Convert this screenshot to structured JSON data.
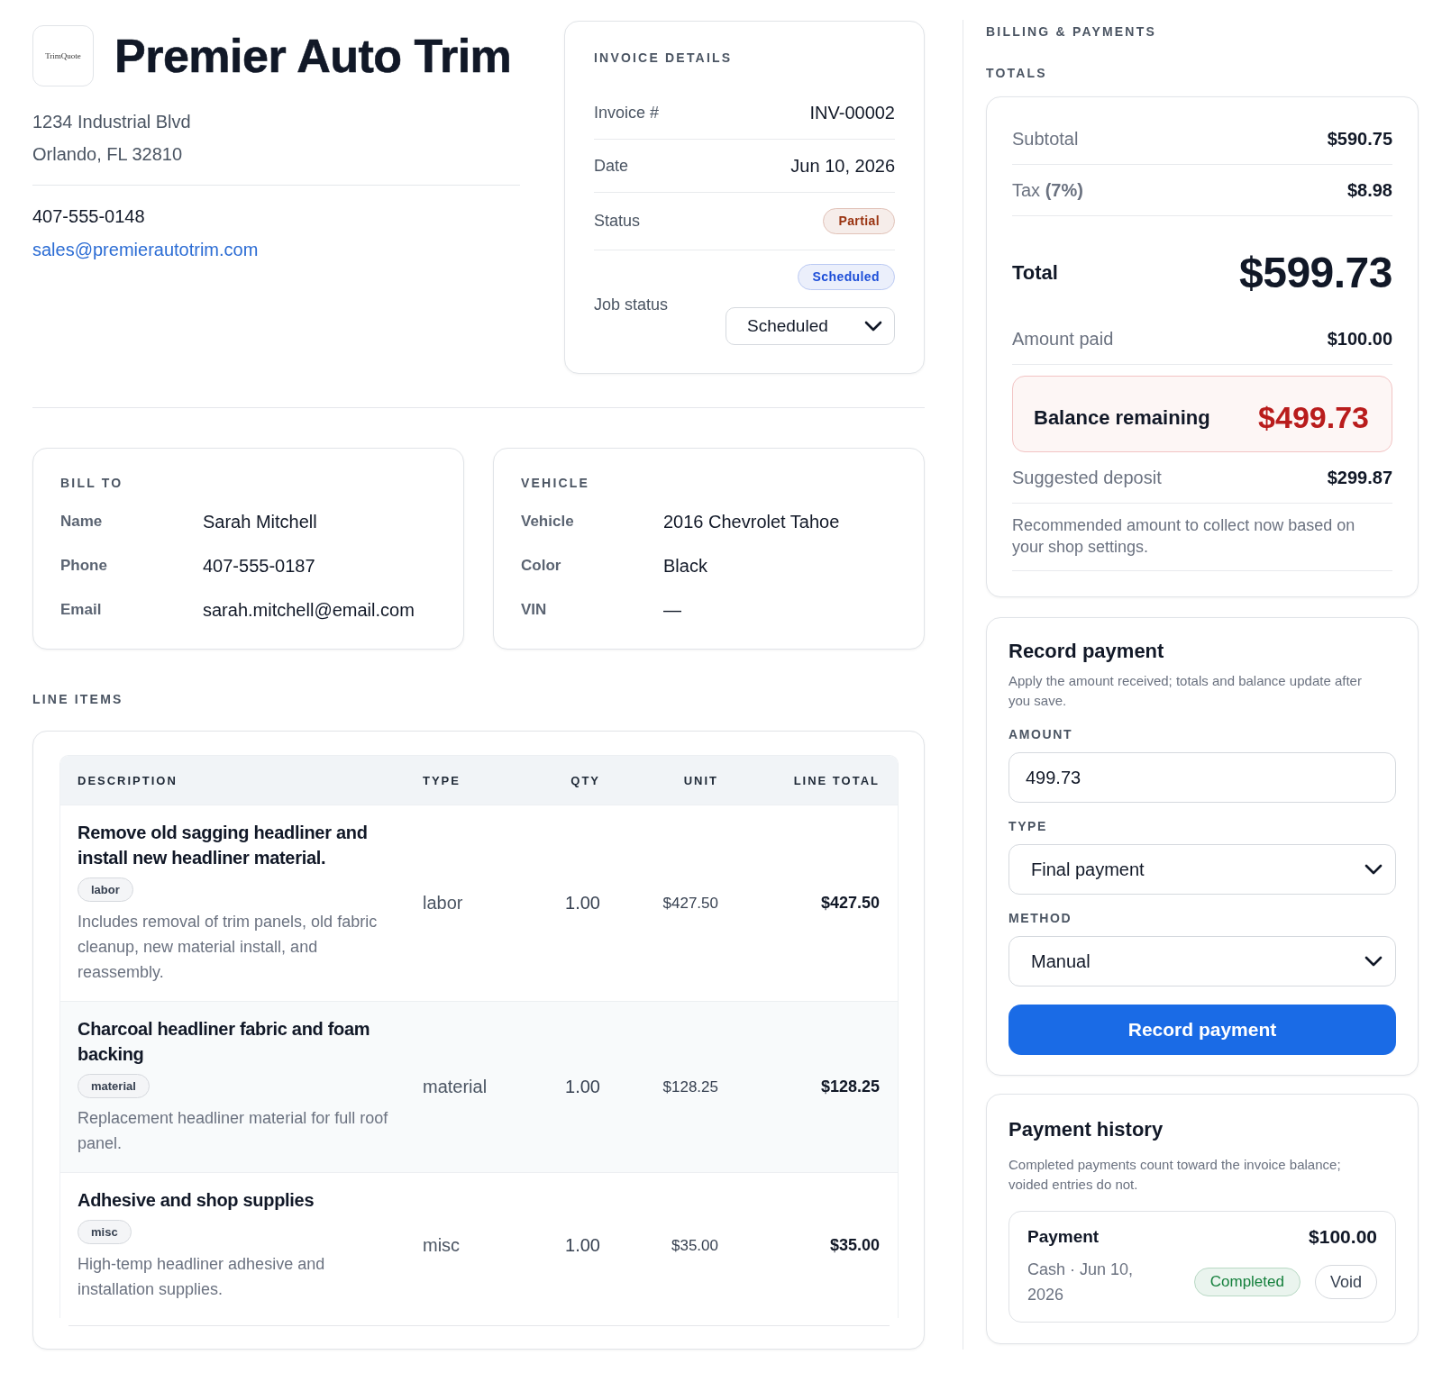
{
  "business": {
    "logo_text": "TrimQuote",
    "name": "Premier Auto Trim",
    "address_lines": [
      "1234 Industrial Blvd",
      "Orlando, FL 32810"
    ],
    "phone": "407-555-0148",
    "email": "sales@premierautotrim.com"
  },
  "invoice_details": {
    "heading": "INVOICE DETAILS",
    "rows": [
      {
        "kind": "text",
        "label": "Invoice #",
        "value": "INV-00002"
      },
      {
        "kind": "text",
        "label": "Date",
        "value": "Jun 10, 2026"
      },
      {
        "kind": "badge",
        "label": "Status",
        "value": "Partial",
        "color": "#9a3412"
      }
    ],
    "job_status": {
      "label": "Job status",
      "badge": {
        "label": "Scheduled",
        "color": "#1d4ed8"
      },
      "value": "Scheduled"
    }
  },
  "bill_to": {
    "heading": "BILL TO",
    "fields": [
      {
        "label": "Name",
        "value": "Sarah Mitchell"
      },
      {
        "label": "Phone",
        "value": "407-555-0187"
      },
      {
        "label": "Email",
        "value": "sarah.mitchell@email.com"
      }
    ]
  },
  "vehicle": {
    "heading": "VEHICLE",
    "fields": [
      {
        "label": "Vehicle",
        "value": "2016 Chevrolet Tahoe"
      },
      {
        "label": "Color",
        "value": "Black"
      },
      {
        "label": "VIN",
        "value": "—"
      }
    ]
  },
  "line_items": {
    "heading": "LINE ITEMS",
    "columns": [
      "DESCRIPTION",
      "TYPE",
      "QTY",
      "UNIT",
      "LINE TOTAL"
    ],
    "rows": [
      {
        "title": "Remove old sagging headliner and install new headliner material.",
        "tag": "labor",
        "note": "Includes removal of trim panels, old fabric cleanup, new material install, and reassembly.",
        "type": "labor",
        "qty": "1.00",
        "unit": "$427.50",
        "line_total": "$427.50"
      },
      {
        "title": "Charcoal headliner fabric and foam backing",
        "tag": "material",
        "note": "Replacement headliner material for full roof panel.",
        "type": "material",
        "qty": "1.00",
        "unit": "$128.25",
        "line_total": "$128.25"
      },
      {
        "title": "Adhesive and shop supplies",
        "tag": "misc",
        "note": "High-temp headliner adhesive and installation supplies.",
        "type": "misc",
        "qty": "1.00",
        "unit": "$35.00",
        "line_total": "$35.00"
      }
    ]
  },
  "billing": {
    "heading": "BILLING & PAYMENTS",
    "totals": {
      "heading": "TOTALS",
      "rows": [
        {
          "kind": "line",
          "label": "Subtotal",
          "value": "$590.75"
        },
        {
          "kind": "line",
          "label": "Tax **(7%)**",
          "value": "$8.98"
        },
        {
          "kind": "total",
          "label": "Total",
          "value": "$599.73"
        },
        {
          "kind": "line",
          "label": "Amount paid",
          "value": "$100.00"
        },
        {
          "kind": "balance",
          "label": "Balance remaining",
          "value": "$499.73"
        },
        {
          "kind": "line",
          "label": "Suggested deposit",
          "value": "$299.87"
        }
      ],
      "note": "Recommended amount to collect now based on your shop settings."
    }
  },
  "record_payment": {
    "title": "Record payment",
    "help": "Apply the amount received; totals and balance update after you save.",
    "fields": [
      {
        "kind": "input",
        "label": "AMOUNT",
        "value": "499.73"
      },
      {
        "kind": "select",
        "label": "TYPE",
        "value": "Final payment"
      },
      {
        "kind": "select",
        "label": "METHOD",
        "value": "Manual"
      }
    ],
    "button": "Record payment"
  },
  "payment_history": {
    "title": "Payment history",
    "help": "Completed payments count toward the invoice balance; voided entries do not.",
    "payments": [
      {
        "title": "Payment",
        "amount": "$100.00",
        "detail": "Cash · Jun 10, 2026",
        "status": {
          "label": "Completed",
          "color": "#15803d"
        },
        "action": "Void"
      }
    ]
  }
}
